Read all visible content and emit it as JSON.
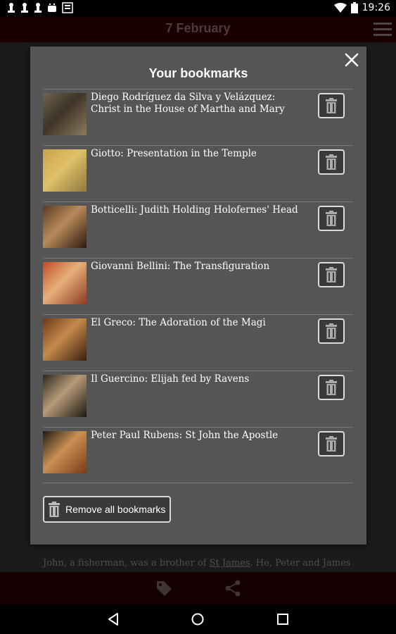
{
  "status_bar": {
    "time": "19:26",
    "left_icons": [
      "chess-pawn-icon",
      "chess-pawn-icon",
      "chess-pawn-icon",
      "android-icon",
      "notification-icon"
    ],
    "right_icons": [
      "wifi-icon",
      "battery-icon"
    ]
  },
  "app_bar": {
    "title": "7 February"
  },
  "background": {
    "text_before": "John, a fisherman, was a brother of ",
    "text_link": "St James",
    "text_after": ". He, Peter and James"
  },
  "dialog": {
    "title": "Your bookmarks",
    "close_icon": "close-icon",
    "bookmarks": [
      {
        "title": "Diego Rodríguez da Silva y Velázquez: Christ in the House of Martha and Mary",
        "thumb_colors": [
          "#6e6350",
          "#3e3426",
          "#8b7a5e"
        ]
      },
      {
        "title": "Giotto: Presentation in the Temple",
        "thumb_colors": [
          "#c9a24a",
          "#e0c06a",
          "#8f7a3f"
        ]
      },
      {
        "title": "Botticelli: Judith Holding Holofernes' Head",
        "thumb_colors": [
          "#5a3a22",
          "#b98a5a",
          "#2a1a10"
        ]
      },
      {
        "title": "Giovanni Bellini: The Transfiguration",
        "thumb_colors": [
          "#c24a2a",
          "#e6b07a",
          "#8e3a22"
        ]
      },
      {
        "title": "El Greco: The Adoration of the Magi",
        "thumb_colors": [
          "#6e3a1a",
          "#c48a4a",
          "#3a1e0e"
        ]
      },
      {
        "title": "Il Guercino: Elijah fed by Ravens",
        "thumb_colors": [
          "#2a2a1e",
          "#b89a78",
          "#1a1a12"
        ]
      },
      {
        "title": "Peter Paul Rubens: St John the Apostle",
        "thumb_colors": [
          "#1e1a16",
          "#c99054",
          "#7a3a18"
        ]
      }
    ],
    "remove_all_label": "Remove all bookmarks"
  },
  "nav_bar": {
    "icons": [
      "back-icon",
      "home-icon",
      "recents-icon"
    ]
  },
  "colors": {
    "dialog_bg": "#555555",
    "button_border": "#dcdcdc",
    "app_bar_bg": "#1a0000"
  }
}
